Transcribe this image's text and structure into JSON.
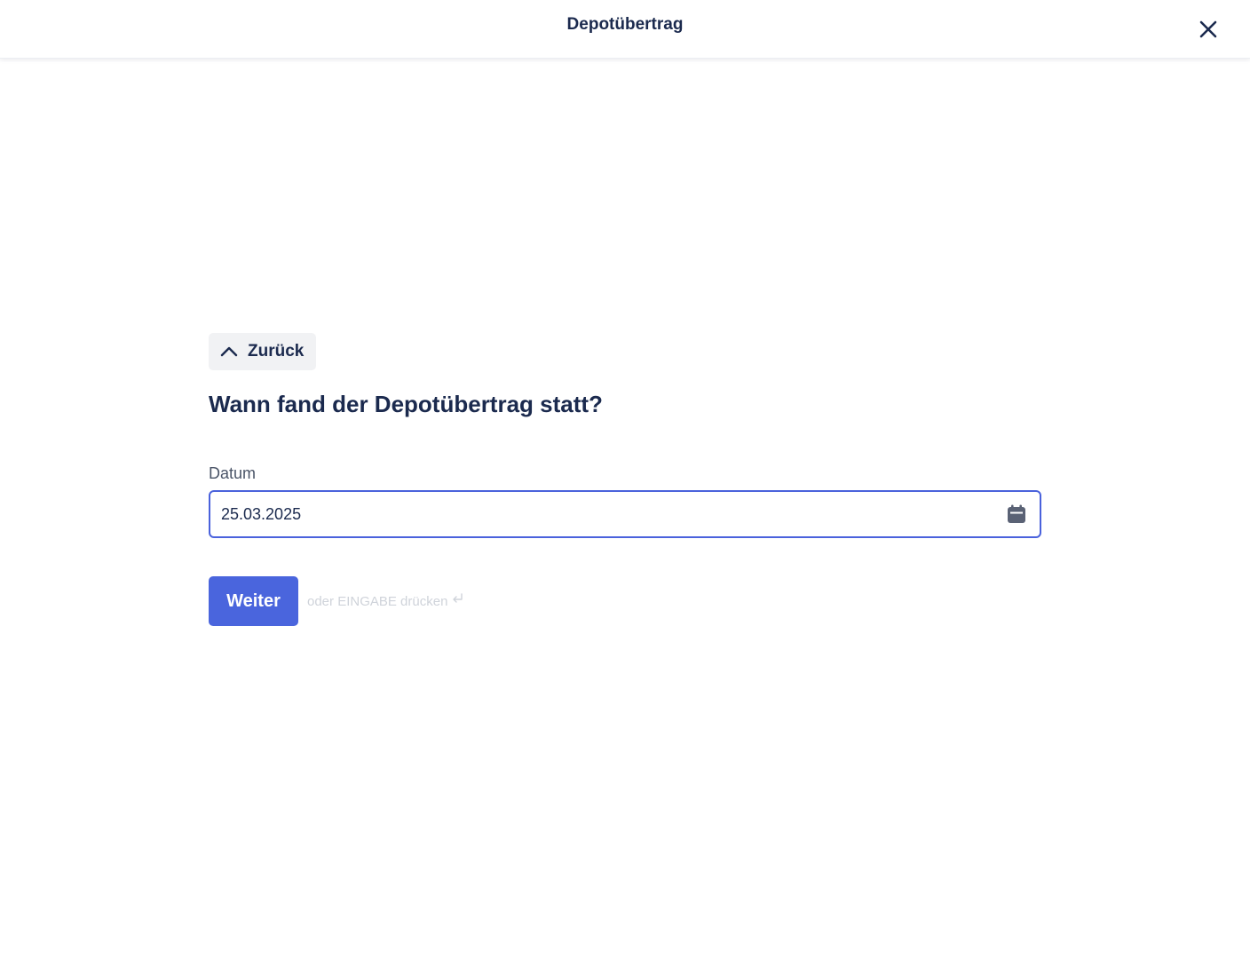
{
  "header": {
    "title": "Depotübertrag",
    "close_icon": "close-icon"
  },
  "back": {
    "label": "Zurück",
    "icon": "chevron-up-icon"
  },
  "question": "Wann fand der Depotübertrag statt?",
  "date_field": {
    "label": "Datum",
    "value": "25.03.2025",
    "icon": "calendar-icon"
  },
  "actions": {
    "next_label": "Weiter",
    "hint": "oder EINGABE drücken",
    "hint_icon": "enter-key-icon"
  },
  "colors": {
    "primary": "#4a65dd",
    "text": "#1b2a4e",
    "focus_border": "#4a62dc",
    "muted": "#cfd3da"
  }
}
